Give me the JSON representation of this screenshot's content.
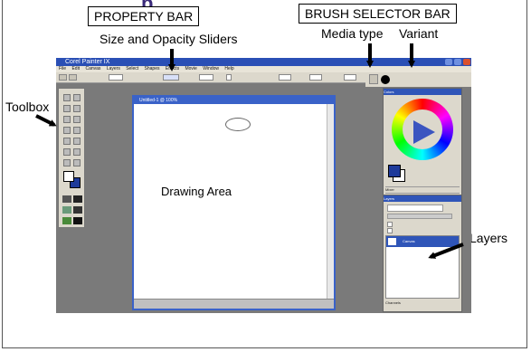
{
  "slide": {
    "title_partial": "p",
    "labels": {
      "property_bar": "PROPERTY BAR",
      "brush_selector_bar": "BRUSH SELECTOR BAR",
      "size_opacity": "Size and Opacity Sliders",
      "media_type": "Media type",
      "variant": "Variant",
      "toolbox": "Toolbox",
      "drawing_area": "Drawing Area",
      "layers": "Layers"
    }
  },
  "app": {
    "window_title": "Corel Painter IX",
    "menu": [
      "File",
      "Edit",
      "Canvas",
      "Layers",
      "Select",
      "Shapes",
      "Effects",
      "Movie",
      "Window",
      "Help"
    ],
    "document_title": "Untitled-1 @ 100%",
    "panels": {
      "colors": "Colors",
      "mixer": "Mixer",
      "color_sets": "Color Sets",
      "layers": "Layers",
      "canvas_layer": "Canvas",
      "channels": "Channels"
    }
  }
}
